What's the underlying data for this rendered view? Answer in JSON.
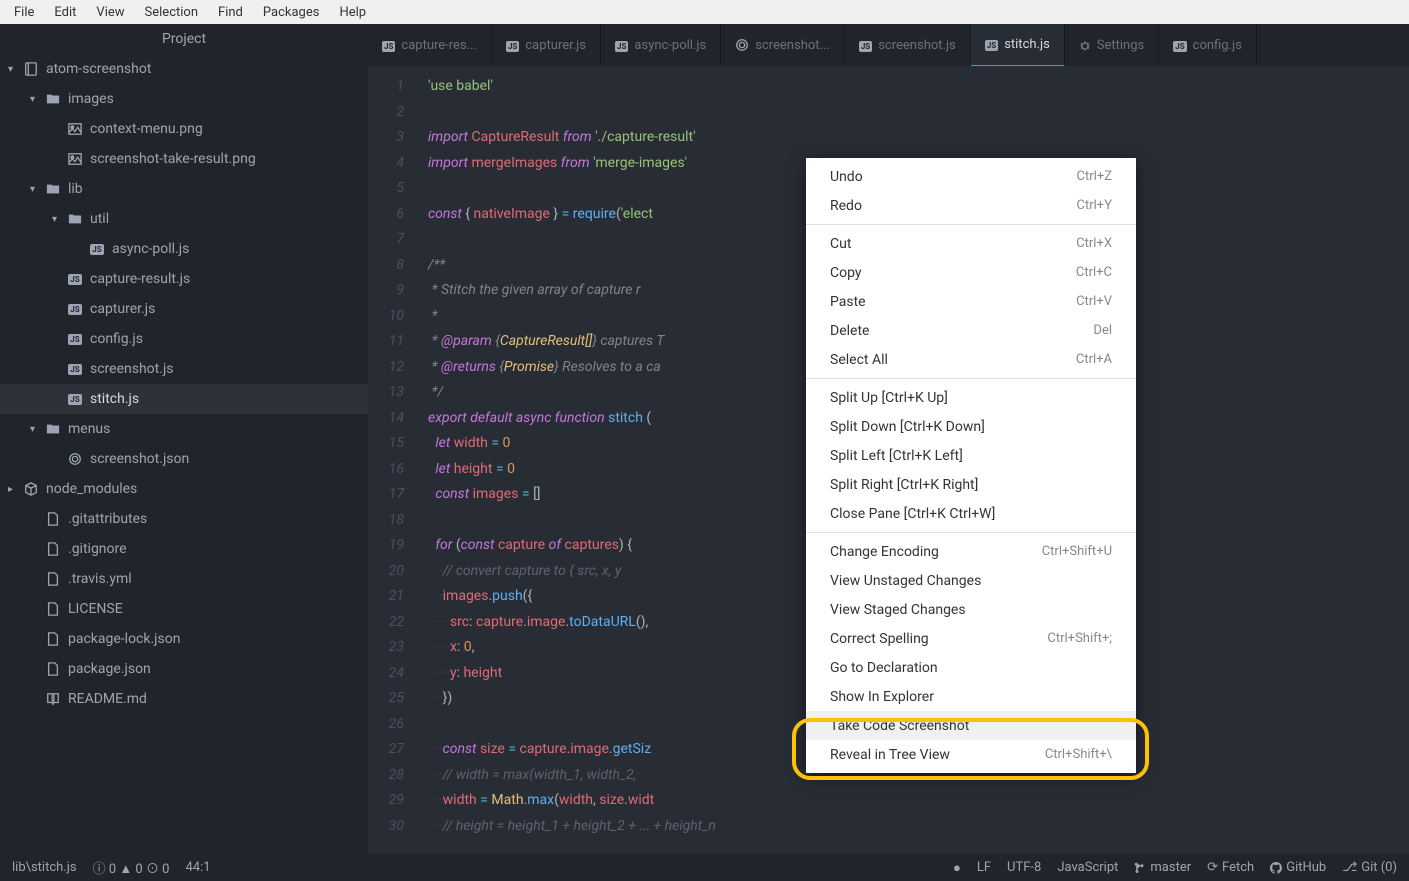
{
  "menubar": [
    "File",
    "Edit",
    "View",
    "Selection",
    "Find",
    "Packages",
    "Help"
  ],
  "sidebar": {
    "title": "Project",
    "tree": [
      {
        "depth": 0,
        "chev": "▾",
        "icon": "repo",
        "label": "atom-screenshot",
        "selected": false
      },
      {
        "depth": 1,
        "chev": "▾",
        "icon": "folder",
        "label": "images",
        "selected": false
      },
      {
        "depth": 2,
        "chev": "",
        "icon": "image",
        "label": "context-menu.png",
        "selected": false
      },
      {
        "depth": 2,
        "chev": "",
        "icon": "image",
        "label": "screenshot-take-result.png",
        "selected": false
      },
      {
        "depth": 1,
        "chev": "▾",
        "icon": "folder",
        "label": "lib",
        "selected": false
      },
      {
        "depth": 2,
        "chev": "▾",
        "icon": "folder",
        "label": "util",
        "selected": false
      },
      {
        "depth": 3,
        "chev": "",
        "icon": "js",
        "label": "async-poll.js",
        "selected": false
      },
      {
        "depth": 2,
        "chev": "",
        "icon": "js",
        "label": "capture-result.js",
        "selected": false
      },
      {
        "depth": 2,
        "chev": "",
        "icon": "js",
        "label": "capturer.js",
        "selected": false
      },
      {
        "depth": 2,
        "chev": "",
        "icon": "js",
        "label": "config.js",
        "selected": false
      },
      {
        "depth": 2,
        "chev": "",
        "icon": "js",
        "label": "screenshot.js",
        "selected": false
      },
      {
        "depth": 2,
        "chev": "",
        "icon": "js",
        "label": "stitch.js",
        "selected": true
      },
      {
        "depth": 1,
        "chev": "▾",
        "icon": "folder",
        "label": "menus",
        "selected": false
      },
      {
        "depth": 2,
        "chev": "",
        "icon": "json",
        "label": "screenshot.json",
        "selected": false
      },
      {
        "depth": 0,
        "chev": "▸",
        "icon": "pkg",
        "label": "node_modules",
        "selected": false
      },
      {
        "depth": 1,
        "chev": "",
        "icon": "file",
        "label": ".gitattributes",
        "selected": false
      },
      {
        "depth": 1,
        "chev": "",
        "icon": "file",
        "label": ".gitignore",
        "selected": false
      },
      {
        "depth": 1,
        "chev": "",
        "icon": "file",
        "label": ".travis.yml",
        "selected": false
      },
      {
        "depth": 1,
        "chev": "",
        "icon": "file",
        "label": "LICENSE",
        "selected": false
      },
      {
        "depth": 1,
        "chev": "",
        "icon": "file",
        "label": "package-lock.json",
        "selected": false
      },
      {
        "depth": 1,
        "chev": "",
        "icon": "file",
        "label": "package.json",
        "selected": false
      },
      {
        "depth": 1,
        "chev": "",
        "icon": "readme",
        "label": "README.md",
        "selected": false
      }
    ]
  },
  "tabs": [
    {
      "icon": "js",
      "label": "capture-res...",
      "active": false
    },
    {
      "icon": "js",
      "label": "capturer.js",
      "active": false
    },
    {
      "icon": "js",
      "label": "async-poll.js",
      "active": false
    },
    {
      "icon": "json",
      "label": "screenshot...",
      "active": false
    },
    {
      "icon": "js",
      "label": "screenshot.js",
      "active": false
    },
    {
      "icon": "js",
      "label": "stitch.js",
      "active": true
    },
    {
      "icon": "gear",
      "label": "Settings",
      "active": false
    },
    {
      "icon": "js",
      "label": "config.js",
      "active": false
    }
  ],
  "code": {
    "lines": [
      {
        "n": 1,
        "html": "<span class='s'>'use babel'</span>"
      },
      {
        "n": 2,
        "html": ""
      },
      {
        "n": 3,
        "html": "<span class='k'>import</span> <span class='v'>CaptureResult</span> <span class='k'>from</span> <span class='s'>'./capture-result'</span>"
      },
      {
        "n": 4,
        "html": "<span class='k'>import</span> <span class='v'>mergeImages</span> <span class='k'>from</span> <span class='s'>'merge-images'</span>"
      },
      {
        "n": 5,
        "html": ""
      },
      {
        "n": 6,
        "html": "<span class='k'>const</span> { <span class='v'>nativeImage</span> } <span class='t'>=</span> <span class='fn'>require</span>(<span class='s'>'elect</span>"
      },
      {
        "n": 7,
        "html": ""
      },
      {
        "n": 8,
        "html": "<span class='doc'>/**</span>"
      },
      {
        "n": 9,
        "html": "<span class='inv'>·</span><span class='doc'>* Stitch the given array of capture r</span>"
      },
      {
        "n": 10,
        "html": "<span class='inv'>·</span><span class='doc'>*</span>"
      },
      {
        "n": 11,
        "html": "<span class='inv'>·</span><span class='doc'>* <span class='k'>@param</span> {<span class='y'>CaptureResult[]</span>} captures T</span>"
      },
      {
        "n": 12,
        "html": "<span class='inv'>·</span><span class='doc'>* <span class='k'>@returns</span> {<span class='y'>Promise</span>} Resolves to a ca</span><span style='margin-left:340px' class='doc'>ge.</span>"
      },
      {
        "n": 13,
        "html": "<span class='inv'>·</span><span class='doc'>*/</span>"
      },
      {
        "n": 14,
        "html": "<span class='k'>export</span> <span class='k'>default</span> <span class='k'>async</span> <span class='k'>function</span> <span class='fn'>stitch</span> ("
      },
      {
        "n": 15,
        "html": "<span class='inv'>··</span><span class='k'>let</span> <span class='v'>width</span> <span class='t'>=</span> <span class='n'>0</span>"
      },
      {
        "n": 16,
        "html": "<span class='inv'>··</span><span class='k'>let</span> <span class='v'>height</span> <span class='t'>=</span> <span class='n'>0</span>"
      },
      {
        "n": 17,
        "html": "<span class='inv'>··</span><span class='k'>const</span> <span class='v'>images</span> <span class='t'>=</span> []"
      },
      {
        "n": 18,
        "html": ""
      },
      {
        "n": 19,
        "html": "<span class='inv'>··</span><span class='k'>for</span> (<span class='k'>const</span> <span class='v'>capture</span> <span class='k'>of</span> <span class='v'>captures</span>) {"
      },
      {
        "n": 20,
        "html": "<span class='inv'>····</span><span class='c'>// convert capture to { src, x, y</span>"
      },
      {
        "n": 21,
        "html": "<span class='inv'>····</span><span class='v'>images</span>.<span class='fn'>push</span>({"
      },
      {
        "n": 22,
        "html": "<span class='inv'>······</span><span class='v'>src</span>: <span class='v'>capture</span>.<span class='v'>image</span>.<span class='fn'>toDataURL</span>(),"
      },
      {
        "n": 23,
        "html": "<span class='inv'>······</span><span class='v'>x</span>: <span class='n'>0</span>,"
      },
      {
        "n": 24,
        "html": "<span class='inv'>······</span><span class='v'>y</span>: <span class='v'>height</span>"
      },
      {
        "n": 25,
        "html": "<span class='inv'>····</span>})"
      },
      {
        "n": 26,
        "html": ""
      },
      {
        "n": 27,
        "html": "<span class='inv'>····</span><span class='k'>const</span> <span class='v'>size</span> <span class='t'>=</span> <span class='v'>capture</span>.<span class='v'>image</span>.<span class='fn'>getSiz</span>"
      },
      {
        "n": 28,
        "html": "<span class='inv'>····</span><span class='c'>// width = max(width_1, width_2,</span>"
      },
      {
        "n": 29,
        "html": "<span class='inv'>····</span><span class='v'>width</span> <span class='t'>=</span> <span class='y'>Math</span>.<span class='fn'>max</span>(<span class='v'>width</span>, <span class='v'>size</span>.<span class='v'>widt</span>"
      },
      {
        "n": 30,
        "html": "<span class='inv'>····</span><span class='c'>// height = height_1 + height_2 + ... + height_n</span>"
      }
    ]
  },
  "context_menu": [
    {
      "label": "Undo",
      "shortcut": "Ctrl+Z"
    },
    {
      "label": "Redo",
      "shortcut": "Ctrl+Y"
    },
    {
      "sep": true
    },
    {
      "label": "Cut",
      "shortcut": "Ctrl+X"
    },
    {
      "label": "Copy",
      "shortcut": "Ctrl+C"
    },
    {
      "label": "Paste",
      "shortcut": "Ctrl+V"
    },
    {
      "label": "Delete",
      "shortcut": "Del"
    },
    {
      "label": "Select All",
      "shortcut": "Ctrl+A"
    },
    {
      "sep": true
    },
    {
      "label": "Split Up [Ctrl+K Up]",
      "shortcut": ""
    },
    {
      "label": "Split Down [Ctrl+K Down]",
      "shortcut": ""
    },
    {
      "label": "Split Left [Ctrl+K Left]",
      "shortcut": ""
    },
    {
      "label": "Split Right [Ctrl+K Right]",
      "shortcut": ""
    },
    {
      "label": "Close Pane [Ctrl+K Ctrl+W]",
      "shortcut": ""
    },
    {
      "sep": true
    },
    {
      "label": "Change Encoding",
      "shortcut": "Ctrl+Shift+U"
    },
    {
      "label": "View Unstaged Changes",
      "shortcut": ""
    },
    {
      "label": "View Staged Changes",
      "shortcut": ""
    },
    {
      "label": "Correct Spelling",
      "shortcut": "Ctrl+Shift+;"
    },
    {
      "label": "Go to Declaration",
      "shortcut": ""
    },
    {
      "label": "Show In Explorer",
      "shortcut": ""
    },
    {
      "label": "Take Code Screenshot",
      "shortcut": "",
      "highlighted": true
    },
    {
      "label": "Reveal in Tree View",
      "shortcut": "Ctrl+Shift+\\"
    }
  ],
  "statusbar": {
    "path": "lib\\stitch.js",
    "diag": "ⓘ 0 ▲ 0 ⊙ 0",
    "cursor": "44:1",
    "dirty": "●",
    "eol": "LF",
    "encoding": "UTF-8",
    "lang": "JavaScript",
    "branch": "master",
    "fetch": "Fetch",
    "github": "GitHub",
    "git": "Git (0)"
  }
}
